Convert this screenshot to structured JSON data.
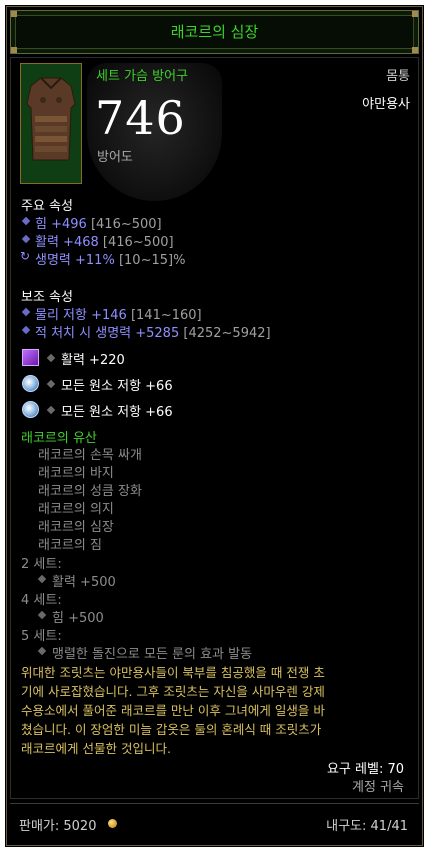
{
  "item": {
    "name": "래코르의 심장",
    "type": "세트 가슴 방어구",
    "slot": "몸통",
    "class": "야만용사",
    "armor_value": "746",
    "armor_label": "방어도"
  },
  "primary": {
    "header": "주요 속성",
    "stats": [
      {
        "value": "힘 +496",
        "range": "[416~500]"
      },
      {
        "value": "활력 +468",
        "range": "[416~500]"
      },
      {
        "value": "생명력 +11%",
        "range": "[10~15]%"
      }
    ]
  },
  "secondary": {
    "header": "보조 속성",
    "stats": [
      {
        "value": "물리 저항 +146",
        "range": "[141~160]"
      },
      {
        "value": "적 처치 시 생명력 +5285",
        "range": "[4252~5942]"
      }
    ]
  },
  "sockets": [
    {
      "gem": "amethyst",
      "text": "활력 +220"
    },
    {
      "gem": "diamond",
      "text": "모든 원소 저항 +66"
    },
    {
      "gem": "diamond",
      "text": "모든 원소 저항 +66"
    }
  ],
  "set": {
    "name": "래코르의 유산",
    "pieces": [
      "래코르의 손목 싸개",
      "래코르의 바지",
      "래코르의 성큼 장화",
      "래코르의 의지",
      "래코르의 심장",
      "래코르의 짐"
    ],
    "bonuses": [
      {
        "label": "2 세트:",
        "text": "활력 +500"
      },
      {
        "label": "4 세트:",
        "text": "힘 +500"
      },
      {
        "label": "5 세트:",
        "text": "맹렬한 돌진으로 모든 룬의 효과 발동"
      }
    ]
  },
  "flavor": [
    "위대한 조릿츠는 야만용사들이 북부를 침공했을 때 전쟁 초",
    "기에 사로잡혔습니다. 그후 조릿츠는 자신을 사마우렌 강제",
    "수용소에서 풀어준 래코르를 만난 이후 그녀에게 일생을 바",
    "쳤습니다. 이 장엄한 미늘 갑옷은 둘의 혼례식 때 조릿츠가",
    "래코르에게 선물한 것입니다."
  ],
  "requirements": {
    "level": "요구 레벨: 70",
    "bound": "계정 귀속"
  },
  "footer": {
    "sell_label": "판매가: 5020",
    "durability": "내구도: 41/41"
  },
  "colors": {
    "set_green": "#3fd12c",
    "magic_blue": "#8f8fff",
    "flavor_gold": "#d8c060"
  }
}
